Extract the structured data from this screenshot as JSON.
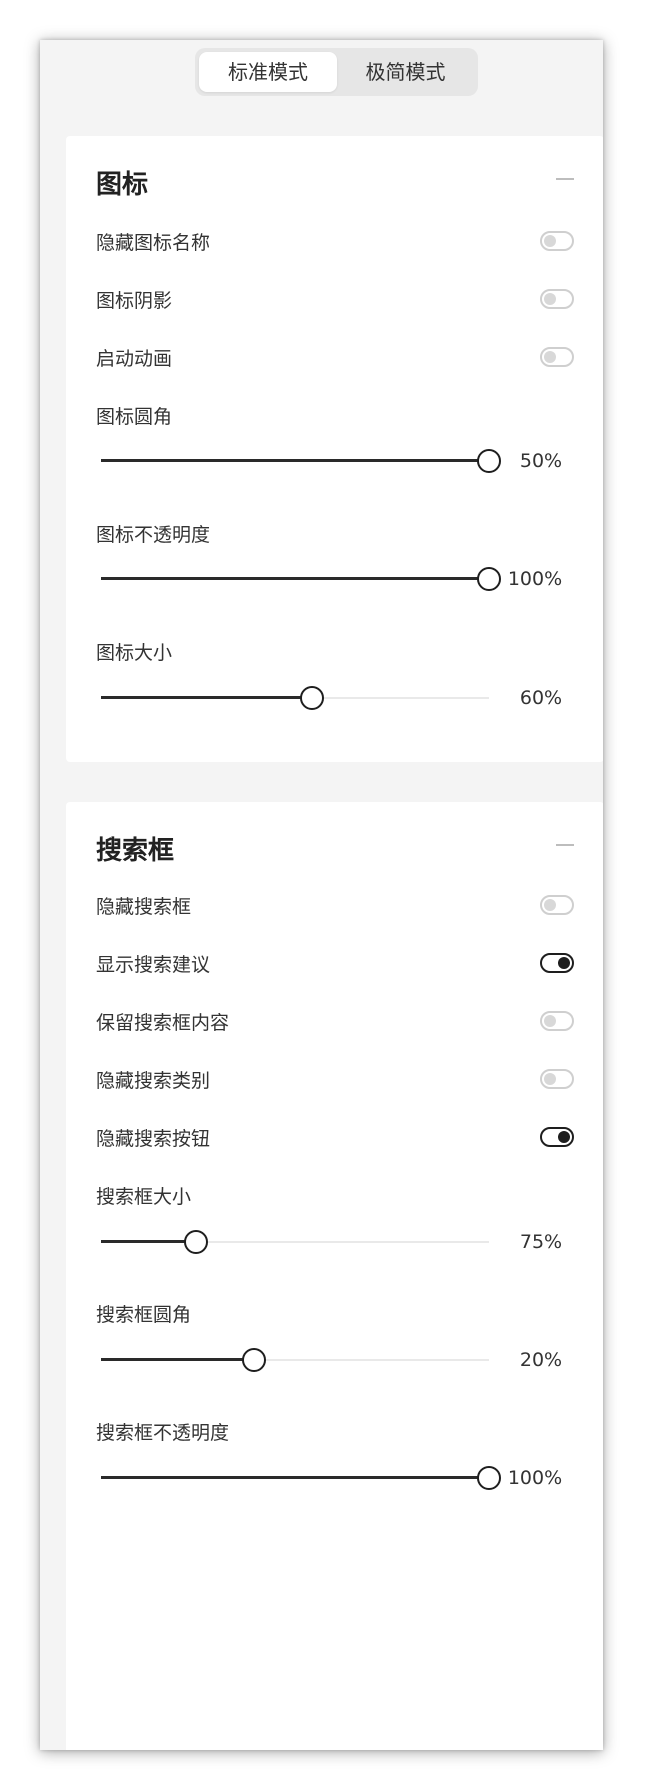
{
  "modes": {
    "standard": "标准模式",
    "minimal": "极简模式"
  },
  "icon_section": {
    "title": "图标",
    "toggles": [
      {
        "label": "隐藏图标名称",
        "on": false
      },
      {
        "label": "图标阴影",
        "on": false
      },
      {
        "label": "启动动画",
        "on": false
      }
    ],
    "sliders": [
      {
        "label": "图标圆角",
        "value": "50%",
        "level": 1.0
      },
      {
        "label": "图标不透明度",
        "value": "100%",
        "level": 1.0
      },
      {
        "label": "图标大小",
        "value": "60%",
        "level": 0.545
      }
    ]
  },
  "search_section": {
    "title": "搜索框",
    "toggles": [
      {
        "label": "隐藏搜索框",
        "on": false
      },
      {
        "label": "显示搜索建议",
        "on": true
      },
      {
        "label": "保留搜索框内容",
        "on": false
      },
      {
        "label": "隐藏搜索类别",
        "on": false
      },
      {
        "label": "隐藏搜索按钮",
        "on": true
      }
    ],
    "sliders": [
      {
        "label": "搜索框大小",
        "value": "75%",
        "level": 0.245
      },
      {
        "label": "搜索框圆角",
        "value": "20%",
        "level": 0.395
      },
      {
        "label": "搜索框不透明度",
        "value": "100%",
        "level": 1.0
      }
    ]
  }
}
